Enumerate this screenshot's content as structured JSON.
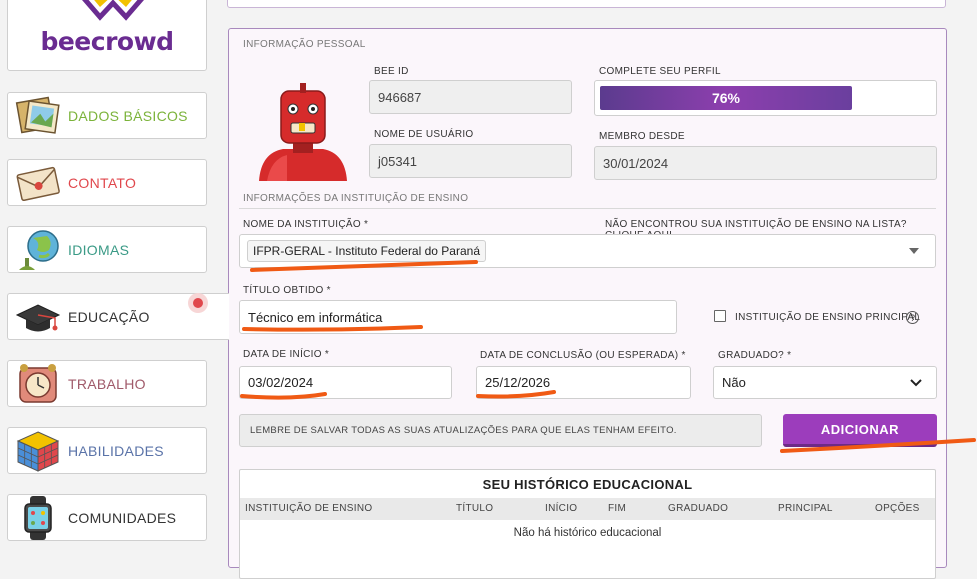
{
  "brand": {
    "name": "beecrowd",
    "color": "#6a2c91"
  },
  "sidebar": {
    "items": [
      {
        "label": "DADOS BÁSICOS",
        "icon": "photos-icon",
        "color": "#7bb33a"
      },
      {
        "label": "CONTATO",
        "icon": "envelope-icon",
        "color": "#e0474c"
      },
      {
        "label": "IDIOMAS",
        "icon": "globe-icon",
        "color": "#3a9a86"
      },
      {
        "label": "EDUCAÇÃO",
        "icon": "graduation-cap-icon",
        "color": "#333333"
      },
      {
        "label": "TRABALHO",
        "icon": "alarm-clock-icon",
        "color": "#a05a6a"
      },
      {
        "label": "HABILIDADES",
        "icon": "rubik-cube-icon",
        "color": "#5a73a8"
      },
      {
        "label": "COMUNIDADES",
        "icon": "smartwatch-icon",
        "color": "#333333"
      }
    ]
  },
  "personal": {
    "section_title": "INFORMAÇÃO PESSOAL",
    "bee_id_label": "BEE ID",
    "bee_id": "946687",
    "profile_label": "COMPLETE SEU PERFIL",
    "profile_progress": "76%",
    "profile_progress_value": 0.76,
    "username_label": "NOME DE USUÁRIO",
    "username": "j05341",
    "member_since_label": "MEMBRO DESDE",
    "member_since": "30/01/2024"
  },
  "institution": {
    "section_title": "INFORMAÇÕES DA INSTITUIÇÃO DE ENSINO",
    "name_label": "NOME DA INSTITUIÇÃO *",
    "not_found_link": "NÃO ENCONTROU SUA INSTITUIÇÃO DE ENSINO NA LISTA? CLIQUE AQUI",
    "name_value": "IFPR-GERAL - Instituto Federal do Paraná",
    "degree_label": "TÍTULO OBTIDO *",
    "degree_value": "Técnico em informática",
    "main_checkbox_label": "INSTITUIÇÃO DE ENSINO PRINCIPAL",
    "help": "?",
    "start_label": "DATA DE INÍCIO *",
    "start_value": "03/02/2024",
    "end_label": "DATA DE CONCLUSÃO (OU ESPERADA) *",
    "end_value": "25/12/2026",
    "graduated_label": "GRADUADO? *",
    "graduated_value": "Não",
    "notice": "LEMBRE DE SALVAR TODAS AS SUAS ATUALIZAÇÕES PARA QUE ELAS TENHAM EFEITO.",
    "add_button": "ADICIONAR"
  },
  "history": {
    "title": "SEU HISTÓRICO EDUCACIONAL",
    "columns": [
      "INSTITUIÇÃO DE ENSINO",
      "TÍTULO",
      "INÍCIO",
      "FIM",
      "GRADUADO",
      "PRINCIPAL",
      "OPÇÕES"
    ],
    "empty": "Não há histórico educacional"
  },
  "annotation_color": "#f05a14"
}
